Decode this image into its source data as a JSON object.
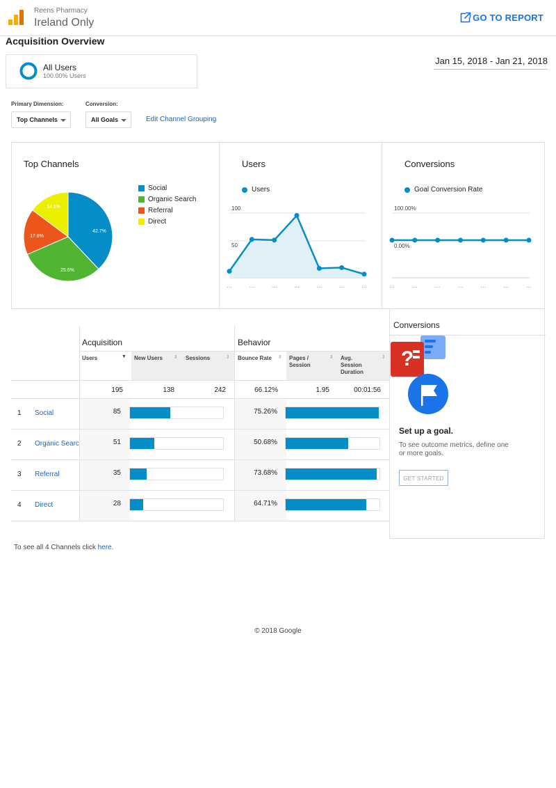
{
  "header": {
    "account": "Reens Pharmacy",
    "property": "Ireland Only",
    "goto_label": "GO TO REPORT"
  },
  "page_title": "Acquisition Overview",
  "segment": {
    "name": "All Users",
    "pct": "100.00% Users"
  },
  "date_range": "Jan 15, 2018 - Jan 21, 2018",
  "controls": {
    "primary_label": "Primary Dimension:",
    "primary_value": "Top Channels",
    "conversion_label": "Conversion:",
    "conversion_value": "All Goals",
    "edit_link": "Edit Channel Grouping"
  },
  "colors": {
    "social": "#058dc7",
    "organic": "#50b432",
    "referral": "#ed561b",
    "direct": "#edef00",
    "accent": "#1a73e8"
  },
  "top_channels": {
    "title": "Top Channels",
    "legend": [
      "Social",
      "Organic Search",
      "Referral",
      "Direct"
    ],
    "slice_labels": [
      "42.7%",
      "25.6%",
      "17.8%",
      "14.1%"
    ]
  },
  "users_panel": {
    "title": "Users",
    "legend": "Users",
    "y_ticks": [
      "100",
      "50"
    ]
  },
  "conversions_panel": {
    "title": "Conversions",
    "legend": "Goal Conversion Rate",
    "y_ticks": [
      "100.00%",
      "0.00%"
    ]
  },
  "chart_data": [
    {
      "type": "pie",
      "title": "Top Channels",
      "categories": [
        "Social",
        "Organic Search",
        "Referral",
        "Direct"
      ],
      "values": [
        42.7,
        25.6,
        17.8,
        14.1
      ]
    },
    {
      "type": "area",
      "title": "Users",
      "series": [
        {
          "name": "Users",
          "values": [
            9,
            53,
            52,
            86,
            13,
            14,
            5
          ]
        }
      ],
      "ylim": [
        0,
        100
      ]
    },
    {
      "type": "line",
      "title": "Conversions",
      "series": [
        {
          "name": "Goal Conversion Rate",
          "values": [
            0,
            0,
            0,
            0,
            0,
            0,
            0
          ]
        }
      ],
      "ylim": [
        0,
        100
      ]
    },
    {
      "type": "table",
      "columns": [
        "Users",
        "New Users",
        "Sessions",
        "Bounce Rate",
        "Pages / Session",
        "Avg. Session Duration"
      ],
      "rows": [
        {
          "name": "Social",
          "users": 85,
          "sessions_fraction": 0.43,
          "bounce": 75.26,
          "bounce_fraction": 0.99
        },
        {
          "name": "Organic Search",
          "users": 51,
          "sessions_fraction": 0.26,
          "bounce": 50.68,
          "bounce_fraction": 0.67
        },
        {
          "name": "Referral",
          "users": 35,
          "sessions_fraction": 0.18,
          "bounce": 73.68,
          "bounce_fraction": 0.97
        },
        {
          "name": "Direct",
          "users": 28,
          "sessions_fraction": 0.14,
          "bounce": 64.71,
          "bounce_fraction": 0.86
        }
      ]
    }
  ],
  "table": {
    "group_acquisition": "Acquisition",
    "group_behavior": "Behavior",
    "headers": [
      "Users",
      "New Users",
      "Sessions",
      "Bounce Rate",
      "Pages /\nSession",
      "Avg.\nSession\nDuration"
    ],
    "totals": [
      "195",
      "138",
      "242",
      "66.12%",
      "1.95",
      "00:01:56"
    ],
    "rows": [
      {
        "num": "1",
        "name": "Social",
        "users": "85",
        "bounce": "75.26%",
        "bar_a": 0.43,
        "bar_b": 0.99
      },
      {
        "num": "2",
        "name": "Organic Search",
        "users": "51",
        "bounce": "50.68%",
        "bar_a": 0.26,
        "bar_b": 0.67
      },
      {
        "num": "3",
        "name": "Referral",
        "users": "35",
        "bounce": "73.68%",
        "bar_a": 0.18,
        "bar_b": 0.97
      },
      {
        "num": "4",
        "name": "Direct",
        "users": "28",
        "bounce": "64.71%",
        "bar_a": 0.14,
        "bar_b": 0.86
      }
    ]
  },
  "goal_panel": {
    "title": "Conversions",
    "heading": "Set up a goal.",
    "description": "To see outcome metrics, define one or more goals.",
    "button": "GET STARTED"
  },
  "footnote": {
    "text": "To see all 4 Channels click ",
    "link": "here",
    "tail": "."
  },
  "copyright": "© 2018 Google"
}
